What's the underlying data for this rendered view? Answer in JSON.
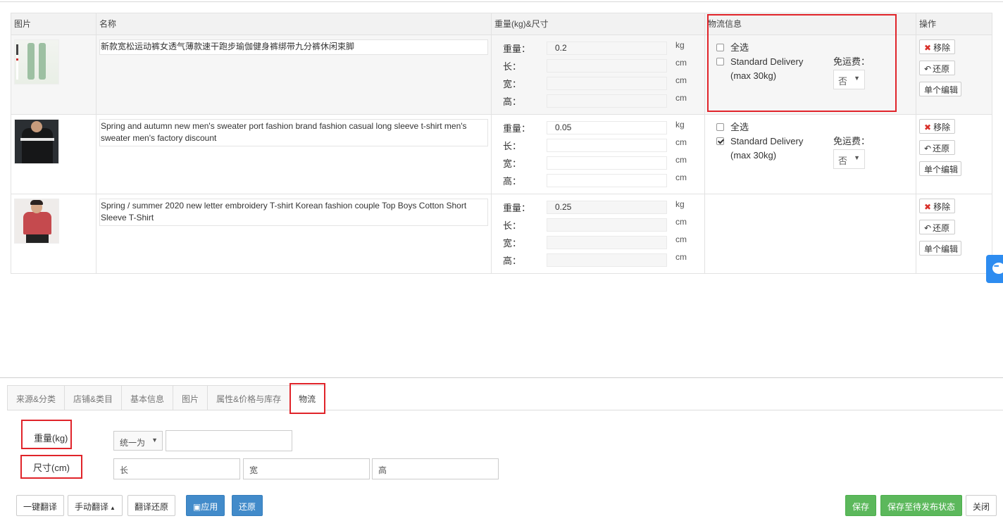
{
  "table": {
    "headers": {
      "image": "图片",
      "name": "名称",
      "weight_size": "重量(kg)&尺寸",
      "logistics": "物流信息",
      "actions": "操作"
    },
    "dim_labels": {
      "weight": "重量：",
      "length": "长：",
      "width": "宽：",
      "height": "高："
    },
    "units": {
      "kg": "kg",
      "cm": "cm"
    },
    "rows": [
      {
        "name": "新款宽松运动裤女透气薄款速干跑步瑜伽健身裤绑带九分裤休闲束脚",
        "weight": "0.2",
        "length": "",
        "width": "",
        "height": "",
        "logistics": {
          "select_all": "全选",
          "select_all_checked": false,
          "shipping": "Standard Delivery (max 30kg)",
          "shipping_checked": false,
          "free_label": "免运费：",
          "free_value": "否"
        }
      },
      {
        "name": "Spring and autumn new men's sweater port fashion brand fashion casual long sleeve t-shirt men's sweater men's factory discount",
        "weight": "0.05",
        "length": "",
        "width": "",
        "height": "",
        "logistics": {
          "select_all": "全选",
          "select_all_checked": false,
          "shipping": "Standard Delivery (max 30kg)",
          "shipping_checked": true,
          "free_label": "免运费：",
          "free_value": "否"
        }
      },
      {
        "name": "Spring / summer 2020 new letter embroidery T-shirt Korean fashion couple Top Boys Cotton Short Sleeve T-Shirt",
        "weight": "0.25",
        "length": "",
        "width": "",
        "height": ""
      }
    ],
    "actions": {
      "remove": "移除",
      "restore": "还原",
      "edit_single": "单个编辑"
    }
  },
  "tabs": [
    "来源&分类",
    "店铺&类目",
    "基本信息",
    "图片",
    "属性&价格与库存",
    "物流"
  ],
  "active_tab": "物流",
  "logistics_form": {
    "weight_label": "重量(kg)",
    "size_label": "尺寸(cm)",
    "unify_select": "统一为",
    "weight_value": "",
    "length_placeholder": "长",
    "width_placeholder": "宽",
    "height_placeholder": "高"
  },
  "footer": {
    "translate_all": "一键翻译",
    "manual_translate": "手动翻译",
    "translate_restore": "翻译还原",
    "apply": "应用",
    "restore": "还原",
    "save": "保存",
    "save_pending": "保存至待发布状态",
    "close": "关闭"
  },
  "colors": {
    "highlight": "#e0242a",
    "primary": "#428bca",
    "success": "#5cb85c",
    "chat": "#2d8cf0"
  }
}
